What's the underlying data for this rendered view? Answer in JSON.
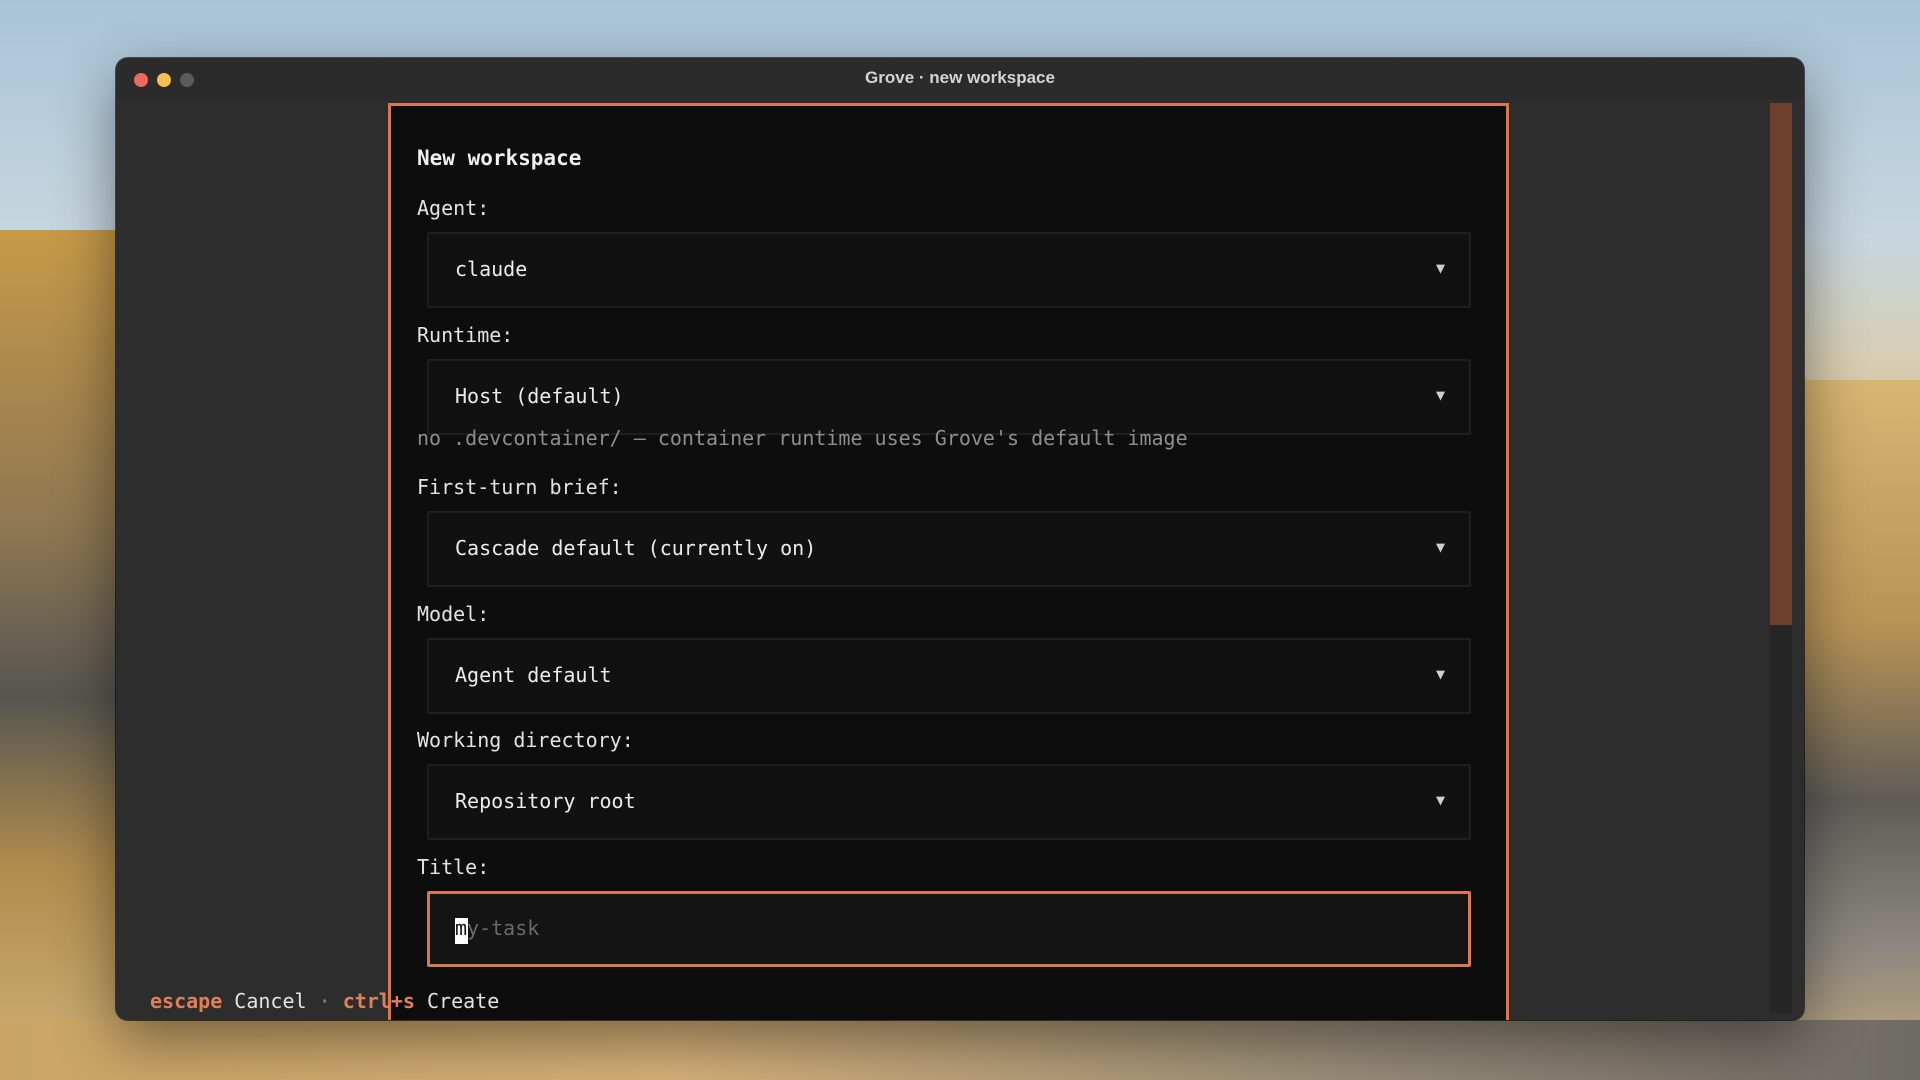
{
  "window": {
    "title": "Grove · new workspace"
  },
  "dialog": {
    "title": "New workspace",
    "fields": {
      "agent": {
        "label": "Agent:",
        "value": "claude",
        "caret": "▼"
      },
      "runtime": {
        "label": "Runtime:",
        "value": "Host (default)",
        "caret": "▼",
        "hint": "no .devcontainer/ — container runtime uses Grove's default image"
      },
      "brief": {
        "label": "First-turn brief:",
        "value": "Cascade default (currently on)",
        "caret": "▼"
      },
      "model": {
        "label": "Model:",
        "value": "Agent default",
        "caret": "▼"
      },
      "workdir": {
        "label": "Working directory:",
        "value": "Repository root",
        "caret": "▼"
      },
      "title": {
        "label": "Title:",
        "placeholder_first": "m",
        "placeholder_rest": "y-task"
      }
    }
  },
  "statusbar": {
    "cancel_key": "escape",
    "cancel_label": "Cancel",
    "separator": "·",
    "create_key": "ctrl+s",
    "create_label": "Create"
  },
  "colors": {
    "accent": "#d7784f",
    "dialog_bg": "#0d0d0d",
    "window_bg": "#2d2d2d"
  }
}
